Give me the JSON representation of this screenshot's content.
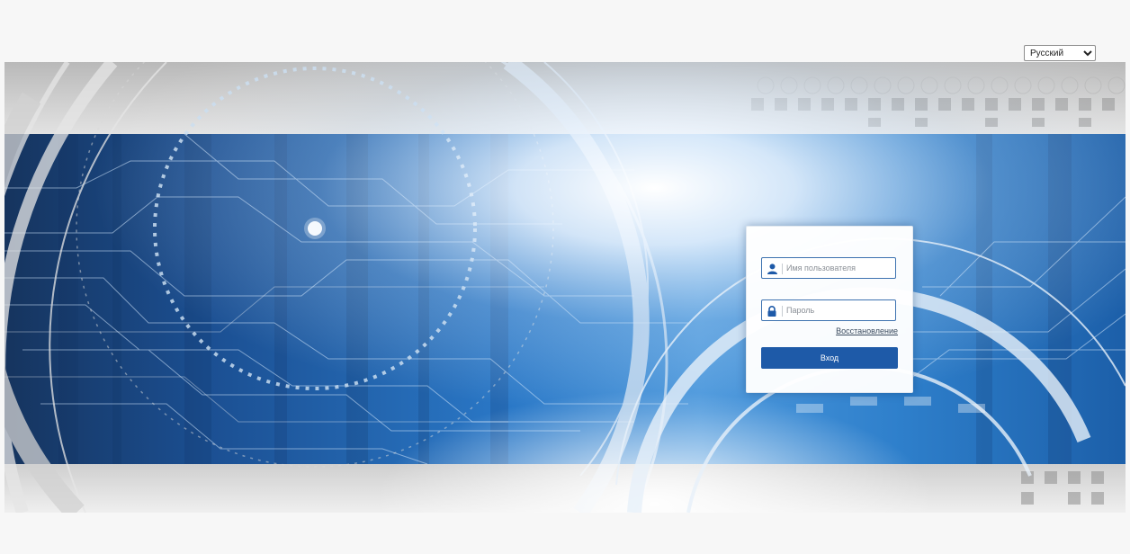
{
  "language_select": {
    "selected": "Русский",
    "options": [
      "Русский"
    ]
  },
  "login": {
    "username_placeholder": "Имя пользователя",
    "username_value": "",
    "password_placeholder": "Пароль",
    "password_value": "",
    "recovery_label": "Восстановление",
    "submit_label": "Вход"
  },
  "icons": {
    "username": "user-icon",
    "password": "lock-icon"
  },
  "colors": {
    "page_background": "#f7f7f7",
    "accent": "#1e5aa8",
    "field_border": "#3d72b0",
    "banner_blue": "#1f6dbb"
  }
}
